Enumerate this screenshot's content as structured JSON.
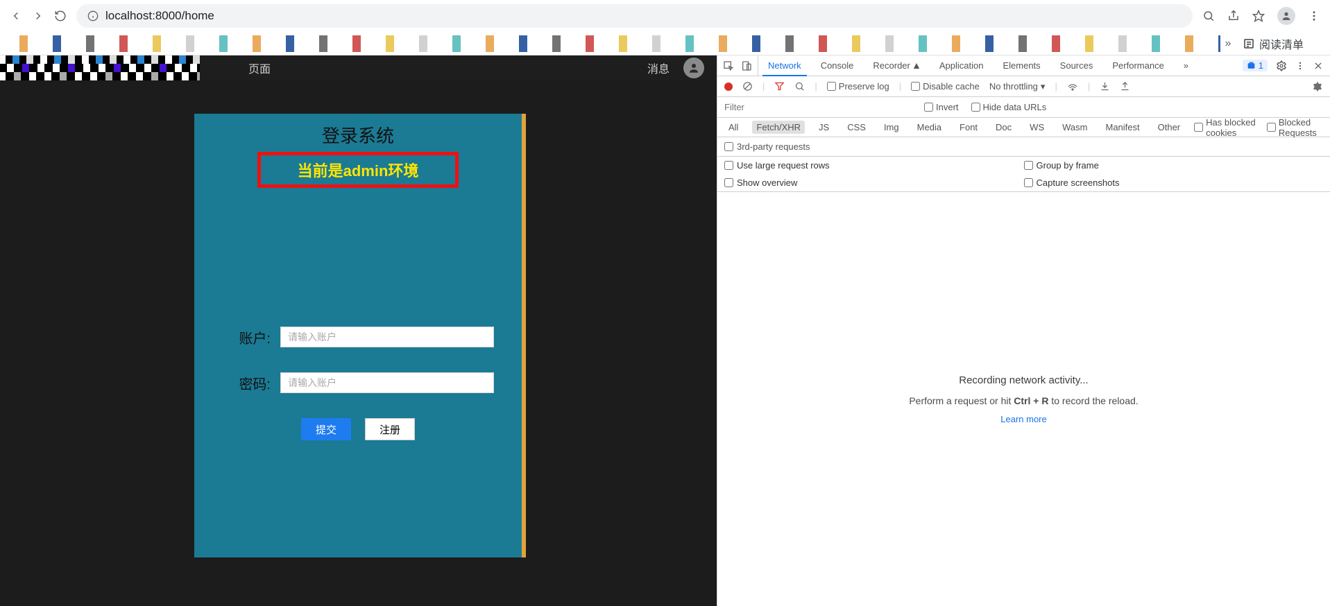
{
  "browser": {
    "url": "localhost:8000/home",
    "reading_list": "阅读清单"
  },
  "app": {
    "nav_tab": "页面",
    "nav_messages": "消息",
    "login_title": "登录系统",
    "env_banner": "当前是admin环境",
    "account_label": "账户:",
    "account_placeholder": "请输入账户",
    "password_label": "密码:",
    "password_placeholder": "请输入账户",
    "submit_btn": "提交",
    "register_btn": "注册"
  },
  "devtools": {
    "tabs": {
      "network": "Network",
      "console": "Console",
      "recorder": "Recorder",
      "application": "Application",
      "elements": "Elements",
      "sources": "Sources",
      "performance": "Performance"
    },
    "issues_count": "1",
    "toolbar": {
      "preserve_log": "Preserve log",
      "disable_cache": "Disable cache",
      "throttling": "No throttling"
    },
    "filter": {
      "placeholder": "Filter",
      "invert": "Invert",
      "hide_data_urls": "Hide data URLs"
    },
    "types": {
      "all": "All",
      "fetch": "Fetch/XHR",
      "js": "JS",
      "css": "CSS",
      "img": "Img",
      "media": "Media",
      "font": "Font",
      "doc": "Doc",
      "ws": "WS",
      "wasm": "Wasm",
      "manifest": "Manifest",
      "other": "Other",
      "blocked_cookies": "Has blocked cookies",
      "blocked_requests": "Blocked Requests"
    },
    "third_party": "3rd-party requests",
    "options": {
      "large_rows": "Use large request rows",
      "group_frame": "Group by frame",
      "overview": "Show overview",
      "screenshots": "Capture screenshots"
    },
    "placeholder": {
      "title": "Recording network activity...",
      "line2a": "Perform a request or hit ",
      "line2b": "Ctrl + R",
      "line2c": " to record the reload.",
      "learn": "Learn more"
    }
  }
}
